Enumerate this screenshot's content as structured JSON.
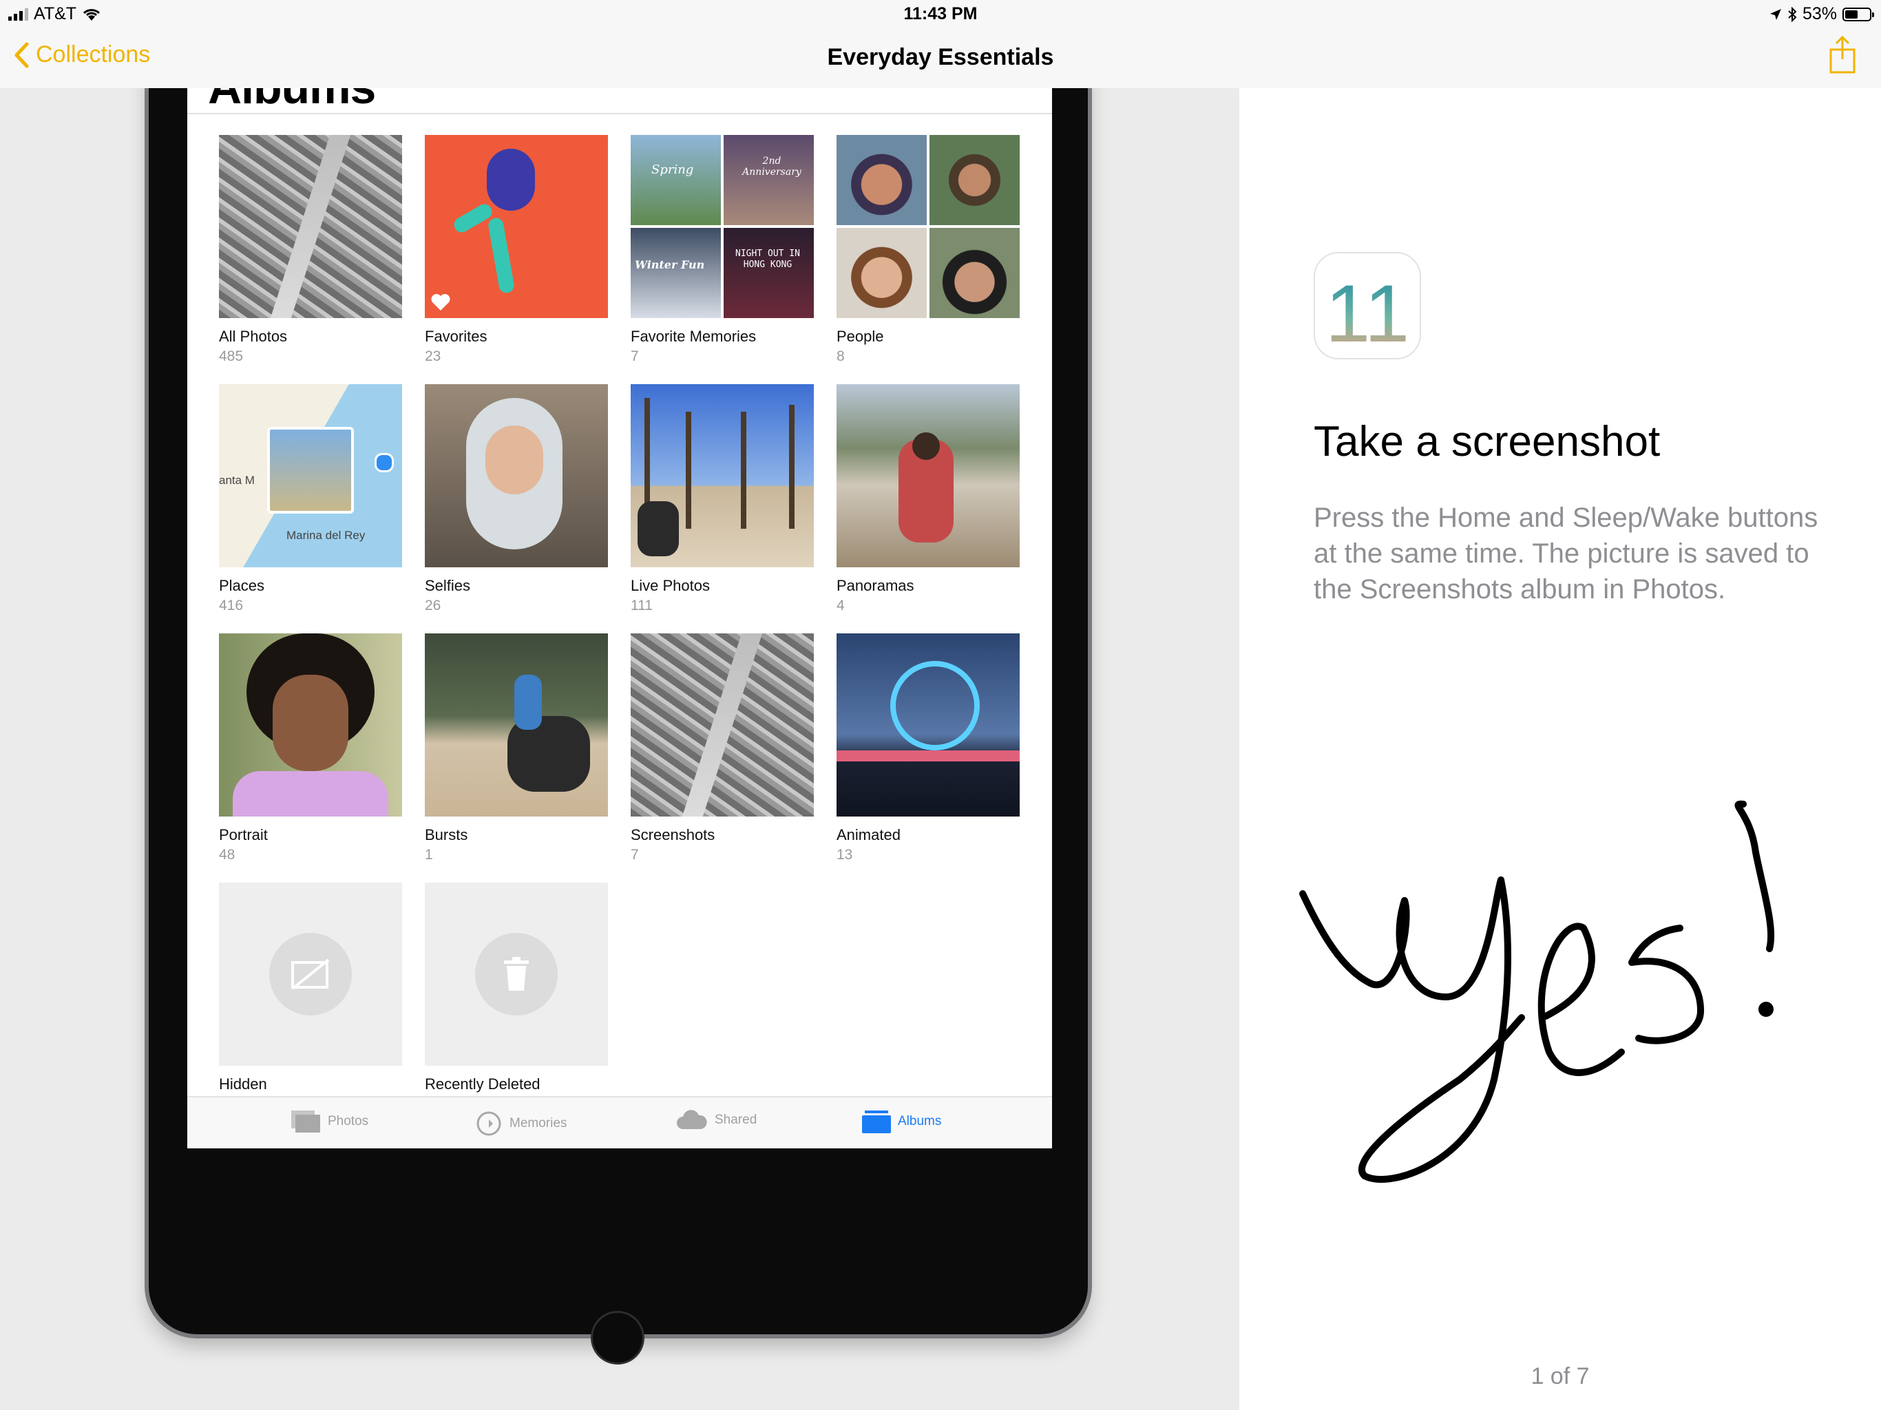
{
  "status_bar": {
    "carrier": "AT&T",
    "time": "11:43 PM",
    "battery": "53%",
    "battery_level": 0.53
  },
  "nav": {
    "back_label": "Collections",
    "title": "Everyday Essentials",
    "accent_color": "#f0b400"
  },
  "screen": {
    "title": "Albums",
    "albums": [
      {
        "name": "All Photos",
        "count": "485"
      },
      {
        "name": "Favorites",
        "count": "23"
      },
      {
        "name": "Favorite Memories",
        "count": "7"
      },
      {
        "name": "People",
        "count": "8"
      },
      {
        "name": "Places",
        "count": "416"
      },
      {
        "name": "Selfies",
        "count": "26"
      },
      {
        "name": "Live Photos",
        "count": "111"
      },
      {
        "name": "Panoramas",
        "count": "4"
      },
      {
        "name": "Portrait",
        "count": "48"
      },
      {
        "name": "Bursts",
        "count": "1"
      },
      {
        "name": "Screenshots",
        "count": "7"
      },
      {
        "name": "Animated",
        "count": "13"
      },
      {
        "name": "Hidden",
        "count": ""
      },
      {
        "name": "Recently Deleted",
        "count": ""
      }
    ],
    "memory_labels": [
      "Spring",
      "2nd Anniversary",
      "Winter Fun",
      "NIGHT OUT IN HONG KONG"
    ],
    "map_labels": [
      "Marina del Rey",
      "anta M"
    ],
    "tabs": [
      {
        "label": "Photos",
        "icon": "photos-icon"
      },
      {
        "label": "Memories",
        "icon": "memories-icon"
      },
      {
        "label": "Shared",
        "icon": "cloud-icon"
      },
      {
        "label": "Albums",
        "icon": "albums-icon"
      }
    ],
    "active_tab": "Albums"
  },
  "tip": {
    "icon_text": "11",
    "heading": "Take a screenshot",
    "body": "Press the Home and Sleep/Wake buttons at the same time. The picture is saved to the Screenshots album in Photos.",
    "annotation": "yes!"
  },
  "pagination": "1 of 7"
}
